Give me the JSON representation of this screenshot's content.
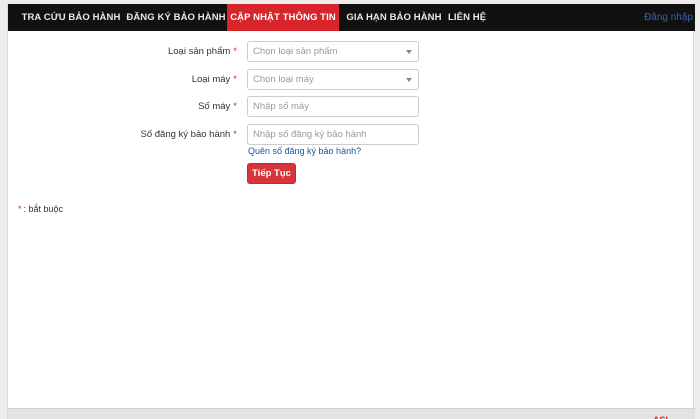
{
  "nav": {
    "items": [
      {
        "label": "TRA CỨU BẢO HÀNH",
        "active": false
      },
      {
        "label": "ĐĂNG KÝ BẢO HÀNH",
        "active": false
      },
      {
        "label": "CẬP NHẬT THÔNG TIN",
        "active": true
      },
      {
        "label": "GIA HẠN BẢO HÀNH",
        "active": false
      },
      {
        "label": "LIÊN HỆ",
        "active": false
      }
    ],
    "login_label": "Đăng nhập"
  },
  "form": {
    "required_mark": "*",
    "product_type": {
      "label": "Loại sản phẩm",
      "selected": "Chọn loại sản phẩm"
    },
    "machine_type": {
      "label": "Loại máy",
      "selected": "Chọn loại máy"
    },
    "machine_number": {
      "label": "Số máy",
      "placeholder": "Nhập số máy",
      "value": ""
    },
    "warranty_number": {
      "label": "Số đăng ký bảo hành",
      "placeholder": "Nhập số đăng ký bảo hành",
      "value": ""
    },
    "forgot_link": "Quên số đăng ký bảo hành?",
    "submit_label": "Tiếp Tục"
  },
  "required_note": {
    "mark": "*",
    "text": ": bắt buộc"
  },
  "colors": {
    "accent": "#d8252b",
    "navbar": "#111111",
    "link": "#1a55a6"
  },
  "icons": {
    "select_caret": "chevron-down-icon"
  }
}
